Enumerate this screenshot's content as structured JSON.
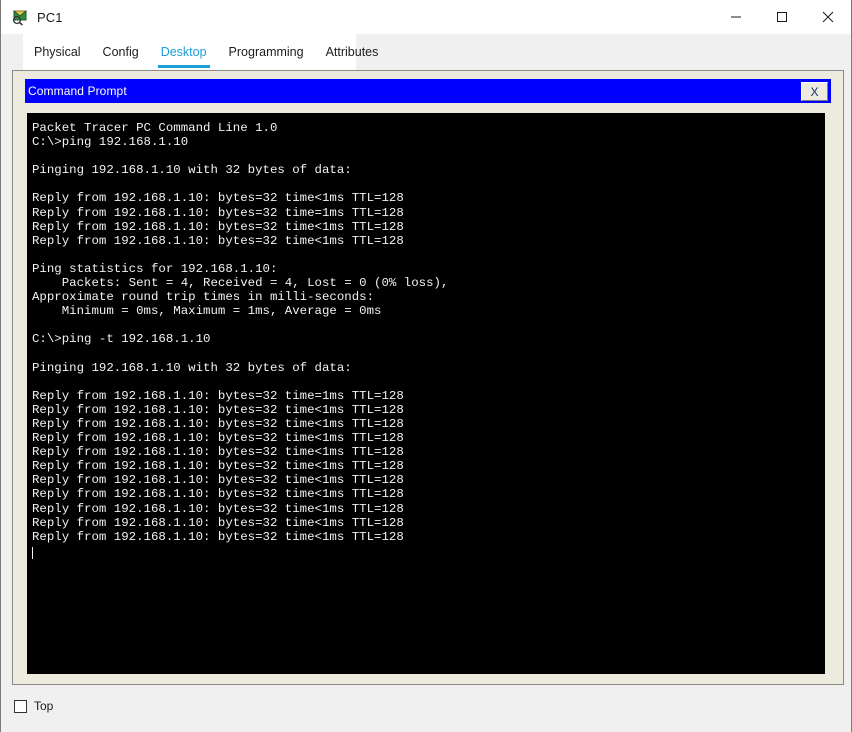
{
  "window": {
    "title": "PC1",
    "icon": "packet-tracer-pc-icon",
    "controls": {
      "minimize": "minimize-icon",
      "maximize": "maximize-icon",
      "close": "close-icon"
    }
  },
  "tabs": [
    {
      "label": "Physical",
      "active": false
    },
    {
      "label": "Config",
      "active": false
    },
    {
      "label": "Desktop",
      "active": true
    },
    {
      "label": "Programming",
      "active": false
    },
    {
      "label": "Attributes",
      "active": false
    }
  ],
  "command_prompt": {
    "title": "Command Prompt",
    "close_label": "X",
    "console_text": "Packet Tracer PC Command Line 1.0\nC:\\>ping 192.168.1.10\n\nPinging 192.168.1.10 with 32 bytes of data:\n\nReply from 192.168.1.10: bytes=32 time<1ms TTL=128\nReply from 192.168.1.10: bytes=32 time=1ms TTL=128\nReply from 192.168.1.10: bytes=32 time<1ms TTL=128\nReply from 192.168.1.10: bytes=32 time<1ms TTL=128\n\nPing statistics for 192.168.1.10:\n    Packets: Sent = 4, Received = 4, Lost = 0 (0% loss),\nApproximate round trip times in milli-seconds:\n    Minimum = 0ms, Maximum = 1ms, Average = 0ms\n\nC:\\>ping -t 192.168.1.10\n\nPinging 192.168.1.10 with 32 bytes of data:\n\nReply from 192.168.1.10: bytes=32 time=1ms TTL=128\nReply from 192.168.1.10: bytes=32 time<1ms TTL=128\nReply from 192.168.1.10: bytes=32 time<1ms TTL=128\nReply from 192.168.1.10: bytes=32 time<1ms TTL=128\nReply from 192.168.1.10: bytes=32 time<1ms TTL=128\nReply from 192.168.1.10: bytes=32 time<1ms TTL=128\nReply from 192.168.1.10: bytes=32 time<1ms TTL=128\nReply from 192.168.1.10: bytes=32 time<1ms TTL=128\nReply from 192.168.1.10: bytes=32 time<1ms TTL=128\nReply from 192.168.1.10: bytes=32 time<1ms TTL=128\nReply from 192.168.1.10: bytes=32 time<1ms TTL=128\n"
  },
  "footer": {
    "top_checkbox_label": "Top",
    "top_checkbox_checked": false
  },
  "colors": {
    "accent_tab": "#1b9fd8",
    "cmd_titlebar": "#0000ff",
    "panel_beige": "#edeade",
    "console_bg": "#000000",
    "console_fg": "#f2f2f2",
    "window_chrome": "#f0f0f0"
  }
}
